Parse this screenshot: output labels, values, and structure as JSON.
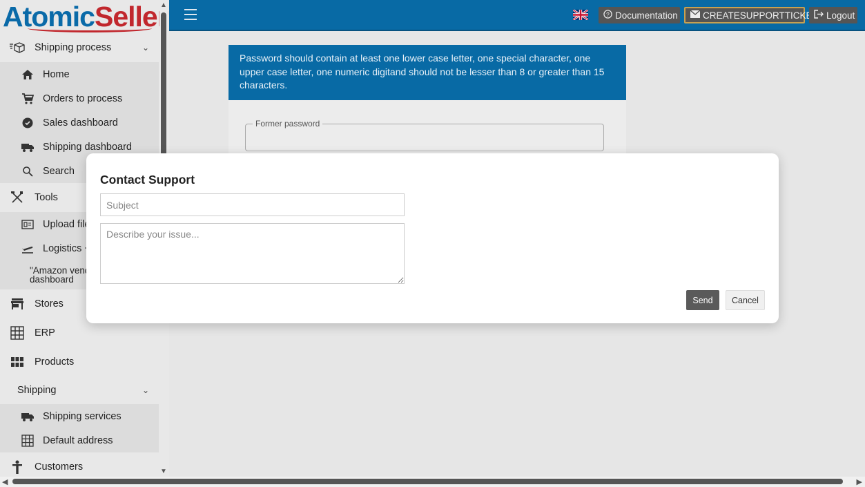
{
  "logo": {
    "part1": "Atomic",
    "part2": "Seller"
  },
  "sidebar": {
    "shipping_process": {
      "label": "Shipping process",
      "chevron": "⌄"
    },
    "shipping_items": [
      {
        "label": "Home",
        "icon": "home-icon"
      },
      {
        "label": "Orders to process",
        "icon": "cart-icon"
      },
      {
        "label": "Sales dashboard",
        "icon": "gear-badge-icon"
      },
      {
        "label": "Shipping dashboard",
        "icon": "truck-icon"
      },
      {
        "label": "Search",
        "icon": "search-icon"
      }
    ],
    "tools": {
      "label": "Tools"
    },
    "tools_items": [
      {
        "label": "Upload file",
        "icon": "upload-icon"
      },
      {
        "label": "Logistics +",
        "icon": "plane-icon"
      }
    ],
    "amazon": {
      "line1": "\"Amazon vend",
      "line2": "dashboard"
    },
    "stores": {
      "label": "Stores"
    },
    "erp": {
      "label": "ERP"
    },
    "products": {
      "label": "Products"
    },
    "shipping": {
      "label": "Shipping",
      "chevron": "⌄"
    },
    "shipping_sub": [
      {
        "label": "Shipping services",
        "icon": "truck-icon"
      },
      {
        "label": "Default address",
        "icon": "grid-icon"
      }
    ],
    "customers": {
      "label": "Customers"
    }
  },
  "topbar": {
    "documentation": "Documentation",
    "ticket": "CREATESUPPORTTICKET",
    "logout": "Logout"
  },
  "card": {
    "banner": "Password should contain at least one lower case letter, one special character, one upper case letter, one numeric digitand should not be lesser than 8 or greater than 15 characters.",
    "former_password_label": "Former password"
  },
  "modal": {
    "title": "Contact Support",
    "subject_placeholder": "Subject",
    "subject_value": "",
    "issue_placeholder": "Describe your issue...",
    "issue_value": "",
    "send_label": "Send",
    "cancel_label": "Cancel"
  },
  "colors": {
    "primary": "#086aa5",
    "logo_blue": "#0a6aa8",
    "logo_red": "#c1272d",
    "send_button": "#5a5a5a"
  }
}
